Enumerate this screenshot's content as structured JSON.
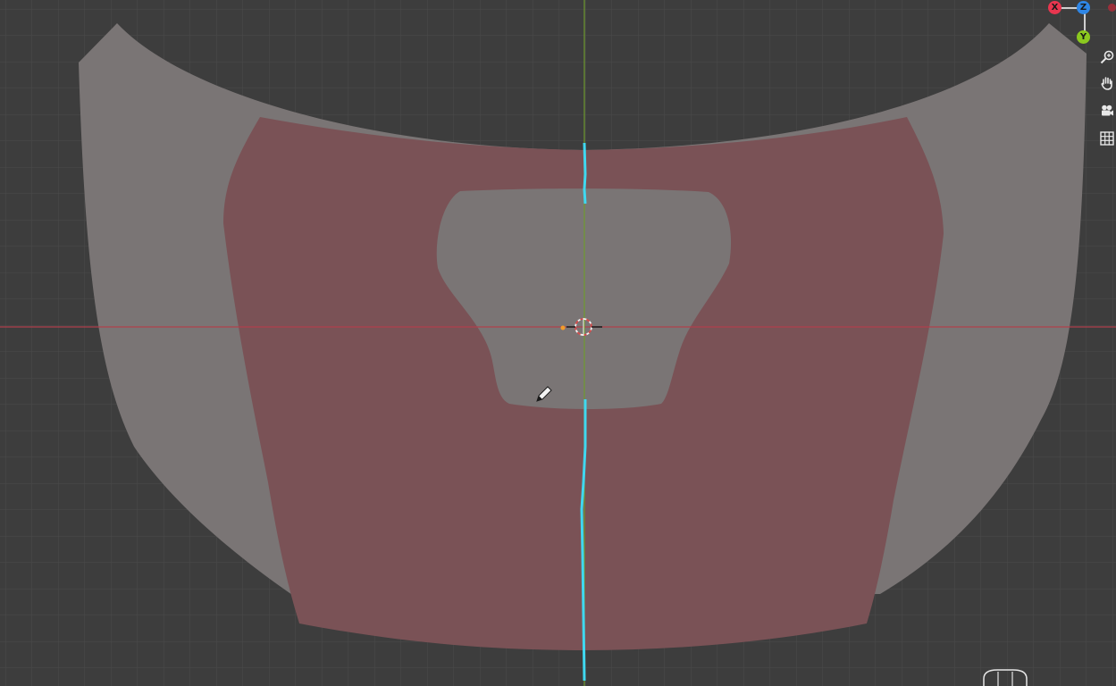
{
  "app": "3D viewport",
  "viewport": {
    "background_color": "#3d3d3d",
    "grid_color": "#4a4a4a",
    "x_axis_color": "#b0404c",
    "y_axis_color": "#6f9a2e"
  },
  "mesh": {
    "outer_color": "#7a7575",
    "inner_face_color": "#7a5256",
    "seam_color": "#3fd8f0"
  },
  "gizmo": {
    "x_label": "X",
    "y_label": "Y",
    "z_label": "Z",
    "x_color": "#e8364f",
    "y_color": "#8bc81f",
    "z_color": "#2e86e6"
  },
  "nav_buttons": [
    {
      "icon": "zoom-icon"
    },
    {
      "icon": "hand-pan-icon"
    },
    {
      "icon": "camera-icon"
    },
    {
      "icon": "grid-icon"
    }
  ],
  "tool": {
    "icon": "pencil-icon"
  }
}
